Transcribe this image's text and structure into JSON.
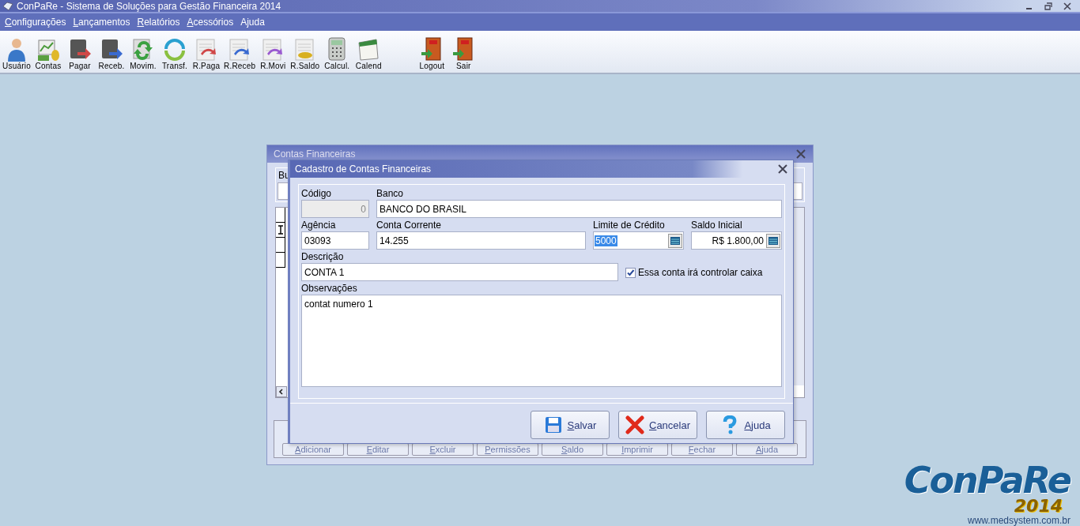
{
  "window": {
    "title": "ConPaRe - Sistema de Soluções para Gestão Financeira 2014"
  },
  "menu": [
    {
      "label": "Configurações",
      "mnemonic": true
    },
    {
      "label": "Lançamentos",
      "mnemonic": true
    },
    {
      "label": "Relatórios",
      "mnemonic": true
    },
    {
      "label": "Acessórios",
      "mnemonic": true
    },
    {
      "label": "Ajuda",
      "mnemonic": false
    }
  ],
  "toolbar": [
    {
      "label": "Usuário"
    },
    {
      "label": "Contas"
    },
    {
      "label": "Pagar"
    },
    {
      "label": "Receb."
    },
    {
      "label": "Movim."
    },
    {
      "label": "Transf."
    },
    {
      "label": "R.Paga"
    },
    {
      "label": "R.Receb"
    },
    {
      "label": "R.Movi"
    },
    {
      "label": "R.Saldo"
    },
    {
      "label": "Calcul."
    },
    {
      "label": "Calend"
    },
    {
      "label": "Logout"
    },
    {
      "label": "Sair"
    }
  ],
  "background_dialog": {
    "title": "Contas Financeiras",
    "search_label": "Bu",
    "buttons": [
      {
        "label": "Adicionar"
      },
      {
        "label": "Editar"
      },
      {
        "label": "Excluir"
      },
      {
        "label": "Permissões"
      },
      {
        "label": "Saldo"
      },
      {
        "label": "Imprimir"
      },
      {
        "label": "Fechar"
      },
      {
        "label": "Ajuda"
      }
    ]
  },
  "dialog": {
    "title": "Cadastro de Contas Financeiras",
    "codigo": {
      "label": "Código",
      "value": "0",
      "disabled": true
    },
    "banco": {
      "label": "Banco",
      "value": "BANCO DO BRASIL"
    },
    "agencia": {
      "label": "Agência",
      "value": "03093"
    },
    "conta": {
      "label": "Conta Corrente",
      "value": "14.255"
    },
    "limite": {
      "label": "Limite de Crédito",
      "value": "5000",
      "highlighted": true
    },
    "saldo": {
      "label": "Saldo Inicial",
      "value": "R$ 1.800,00",
      "highlighted": false
    },
    "descricao": {
      "label": "Descrição",
      "value": "CONTA 1"
    },
    "controla_caixa": {
      "label": "Essa conta irá controlar caixa",
      "checked": true
    },
    "observacoes": {
      "label": "Observações",
      "value": "contat numero 1"
    },
    "buttons": [
      {
        "label": "Salvar",
        "kind": "save"
      },
      {
        "label": "Cancelar",
        "kind": "cancel"
      },
      {
        "label": "Ajuda",
        "kind": "help"
      }
    ]
  },
  "logo": {
    "name": "ConPaRe",
    "year": "2014",
    "url": "www.medsystem.com.br"
  }
}
